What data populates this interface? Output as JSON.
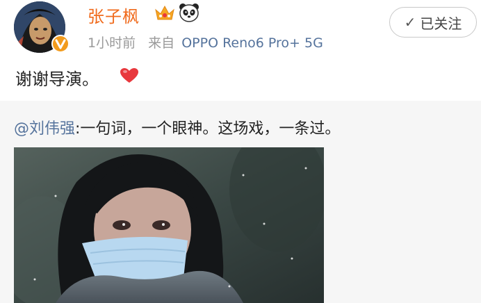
{
  "user": {
    "name": "张子枫",
    "time": "1小时前",
    "source_prefix": "来自",
    "device": "OPPO Reno6 Pro+ 5G"
  },
  "follow_button": {
    "label": "已关注"
  },
  "post": {
    "text": "谢谢导演。"
  },
  "repost": {
    "mention": "@刘伟强",
    "text": ":一句词，一个眼神。这场戏，一条过。"
  },
  "colors": {
    "username": "#f06b1d",
    "link": "#55739c",
    "meta": "#9a9a9a",
    "repost_bg": "#f6f6f6",
    "heart": "#e8383d"
  }
}
